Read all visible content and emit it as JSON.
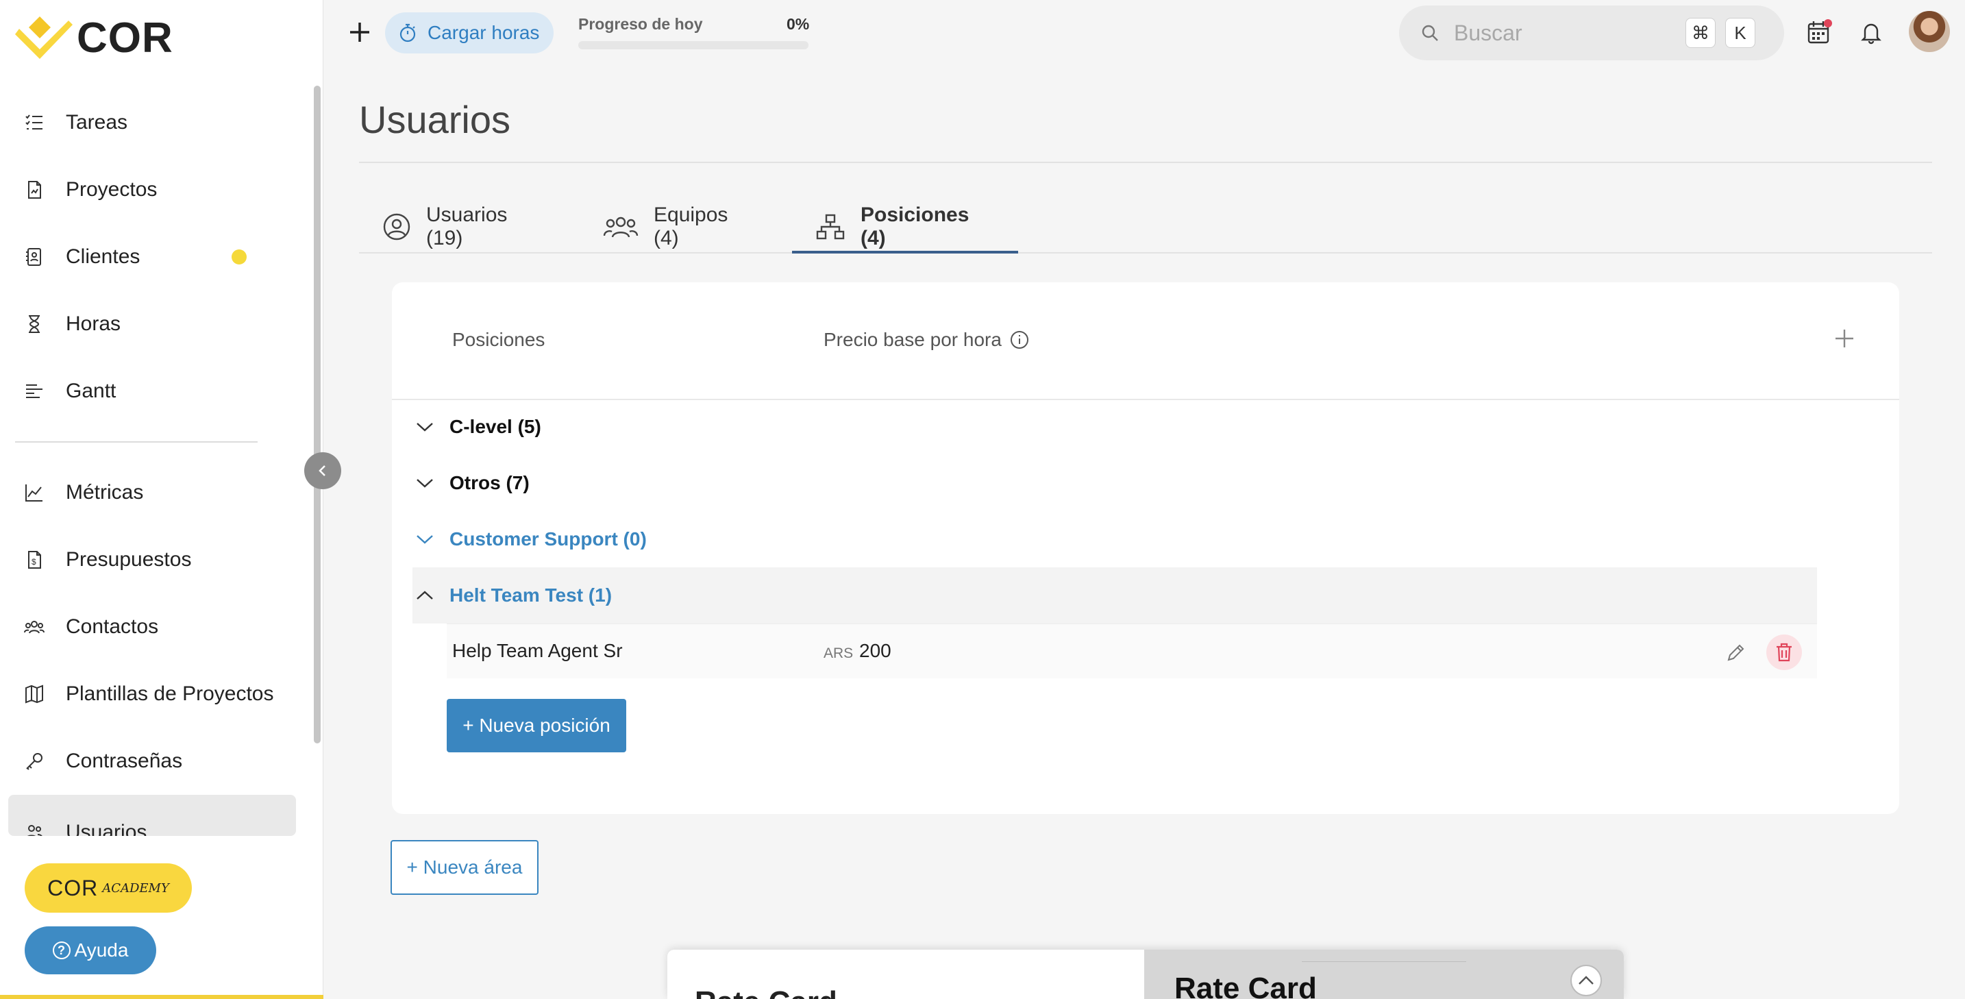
{
  "brand": {
    "name": "COR"
  },
  "sidebar": {
    "items": [
      {
        "label": "Tareas",
        "icon": "tasks-icon"
      },
      {
        "label": "Proyectos",
        "icon": "projects-icon"
      },
      {
        "label": "Clientes",
        "icon": "clients-icon",
        "has_dot": true
      },
      {
        "label": "Horas",
        "icon": "hourglass-icon"
      },
      {
        "label": "Gantt",
        "icon": "gantt-icon"
      },
      {
        "label": "Métricas",
        "icon": "metrics-icon"
      },
      {
        "label": "Presupuestos",
        "icon": "budget-icon"
      },
      {
        "label": "Contactos",
        "icon": "contacts-icon"
      },
      {
        "label": "Plantillas de Proyectos",
        "icon": "map-icon"
      },
      {
        "label": "Contraseñas",
        "icon": "key-icon"
      },
      {
        "label": "Usuarios",
        "icon": "users-icon",
        "active": true
      }
    ],
    "academy": {
      "main": "COR",
      "sub": "ACADEMY"
    },
    "help_label": "Ayuda"
  },
  "topbar": {
    "load_hours_label": "Cargar horas",
    "progress_label": "Progreso de hoy",
    "progress_value": "0%",
    "progress_fraction": 0,
    "search_placeholder": "Buscar",
    "shortcut_keys": [
      "⌘",
      "K"
    ]
  },
  "page": {
    "title": "Usuarios",
    "tabs": [
      {
        "label": "Usuarios (19)",
        "icon": "user-circle-icon"
      },
      {
        "label": "Equipos (4)",
        "icon": "team-icon"
      },
      {
        "label": "Posiciones (4)",
        "icon": "hierarchy-icon",
        "active": true
      }
    ]
  },
  "positions": {
    "col_positions": "Posiciones",
    "col_price": "Precio base por hora",
    "groups": [
      {
        "label": "C-level (5)",
        "expanded": false
      },
      {
        "label": "Otros (7)",
        "expanded": false
      },
      {
        "label": "Customer Support (0)",
        "expanded": false
      },
      {
        "label": "Helt Team Test (1)",
        "expanded": true
      }
    ],
    "rows": [
      {
        "name": "Help Team Agent Sr",
        "currency": "ARS",
        "amount": "200"
      }
    ],
    "new_position_label": "+ Nueva posición",
    "new_area_label": "+ Nueva área"
  },
  "promo": {
    "left_title": "Rate Card",
    "right_title": "Rate Card"
  },
  "colors": {
    "accent": "#3a86c0",
    "brand_yellow": "#f9d73f",
    "tab_underline": "#3a5f8c",
    "delete_red": "#e0455a"
  }
}
